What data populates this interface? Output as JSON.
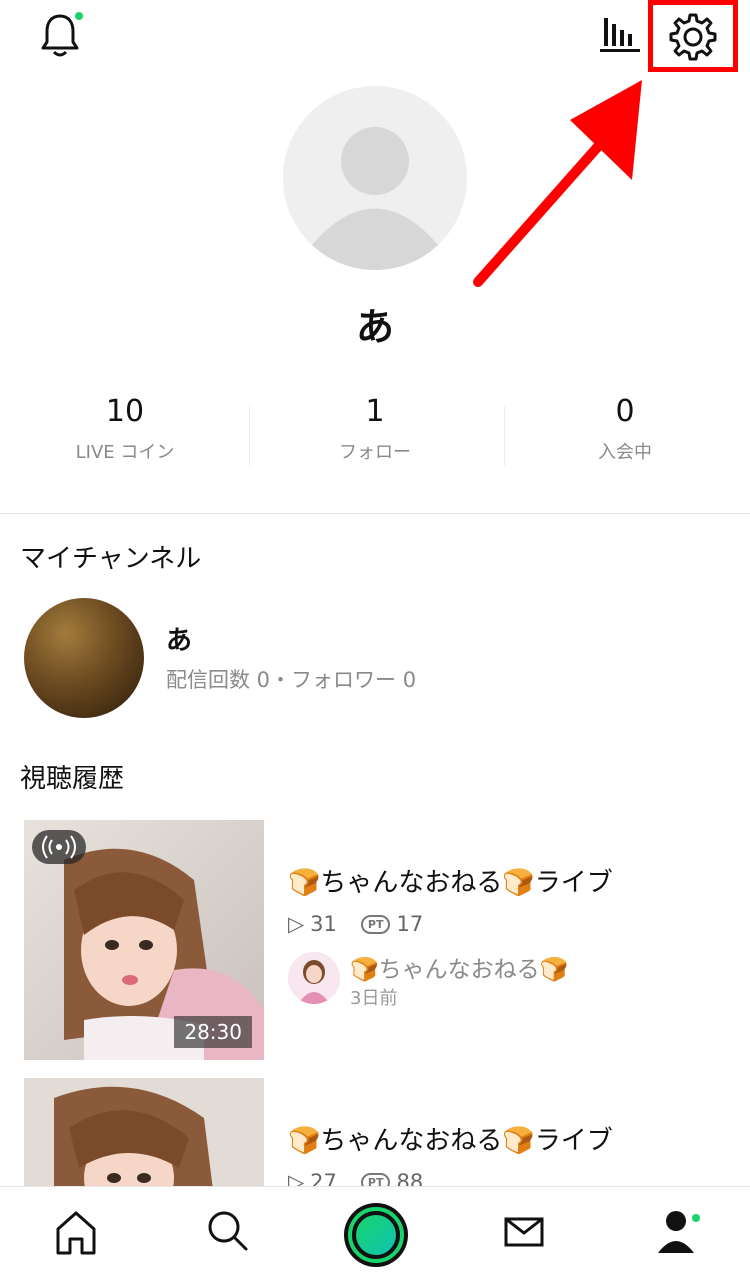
{
  "profile": {
    "name": "あ",
    "stats": [
      {
        "value": "10",
        "label": "LIVE コイン"
      },
      {
        "value": "1",
        "label": "フォロー"
      },
      {
        "value": "0",
        "label": "入会中"
      }
    ]
  },
  "my_channel": {
    "section_title": "マイチャンネル",
    "name": "あ",
    "meta": "配信回数 0・フォロワー 0"
  },
  "history": {
    "section_title": "視聴履歴",
    "items": [
      {
        "title": "🍞ちゃんなおねる🍞ライブ",
        "views": "31",
        "points": "17",
        "duration": "28:30",
        "channel": "🍞ちゃんなおねる🍞",
        "time": "3日前",
        "pt_label": "PT"
      },
      {
        "title": "🍞ちゃんなおねる🍞ライブ",
        "views": "27",
        "points": "88",
        "pt_label": "PT"
      }
    ]
  },
  "icons": [
    "bell-icon",
    "stats-icon",
    "gear-icon",
    "home-icon",
    "search-icon",
    "live-icon",
    "mail-icon",
    "profile-icon"
  ],
  "colors": {
    "accent": "#18d46c",
    "highlight": "#ff0000"
  }
}
